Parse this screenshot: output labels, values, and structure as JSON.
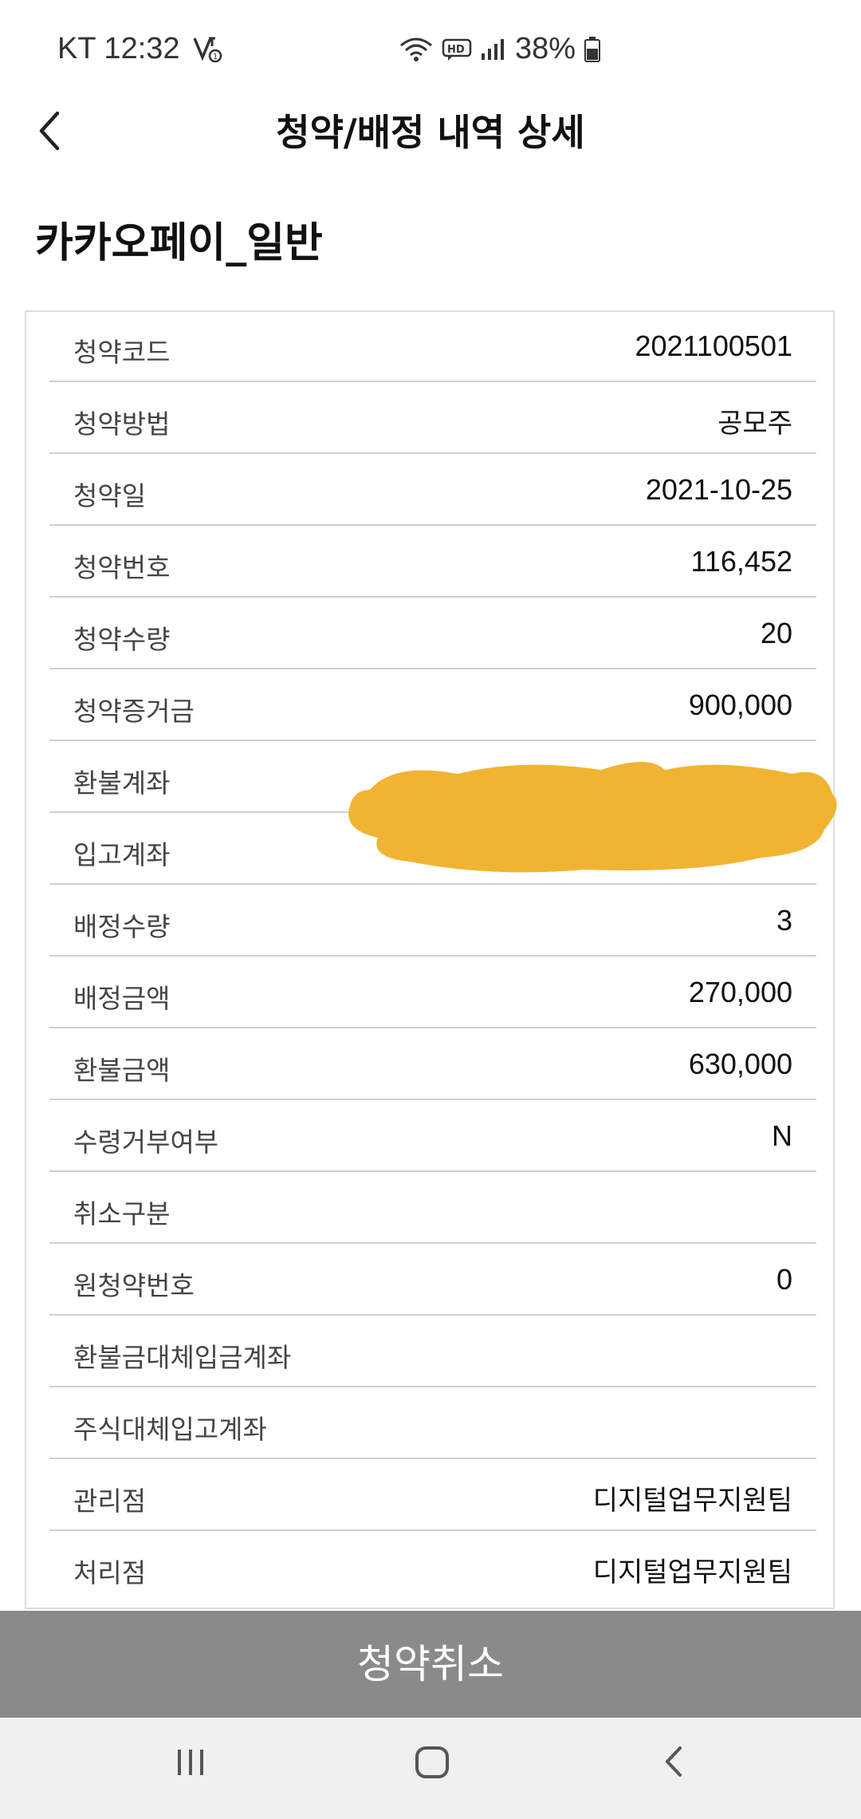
{
  "status_bar": {
    "carrier_time": "KT 12:32",
    "battery": "38%",
    "icons": [
      "call-notification-icon",
      "wifi-icon",
      "hd-voice-icon",
      "signal-icon",
      "battery-icon"
    ]
  },
  "header": {
    "title": "청약/배정 내역 상세",
    "back_icon": "chevron-left-icon"
  },
  "product_name": "카카오페이_일반",
  "details": [
    {
      "label": "청약코드",
      "value": "2021100501"
    },
    {
      "label": "청약방법",
      "value": "공모주"
    },
    {
      "label": "청약일",
      "value": "2021-10-25"
    },
    {
      "label": "청약번호",
      "value": "116,452"
    },
    {
      "label": "청약수량",
      "value": "20"
    },
    {
      "label": "청약증거금",
      "value": "900,000"
    },
    {
      "label": "환불계좌",
      "value": ""
    },
    {
      "label": "입고계좌",
      "value": ""
    },
    {
      "label": "배정수량",
      "value": "3"
    },
    {
      "label": "배정금액",
      "value": "270,000"
    },
    {
      "label": "환불금액",
      "value": "630,000"
    },
    {
      "label": "수령거부여부",
      "value": "N"
    },
    {
      "label": "취소구분",
      "value": ""
    },
    {
      "label": "원청약번호",
      "value": "0"
    },
    {
      "label": "환불금대체입금계좌",
      "value": ""
    },
    {
      "label": "주식대체입고계좌",
      "value": ""
    },
    {
      "label": "관리점",
      "value": "디지털업무지원팀"
    },
    {
      "label": "처리점",
      "value": "디지털업무지원팀"
    }
  ],
  "redaction_color": "#f0b432",
  "cancel_button": {
    "label": "청약취소",
    "color": "#8a8a8a"
  },
  "nav_bar": {
    "items": [
      "recent-apps-icon",
      "home-icon",
      "back-icon"
    ]
  }
}
